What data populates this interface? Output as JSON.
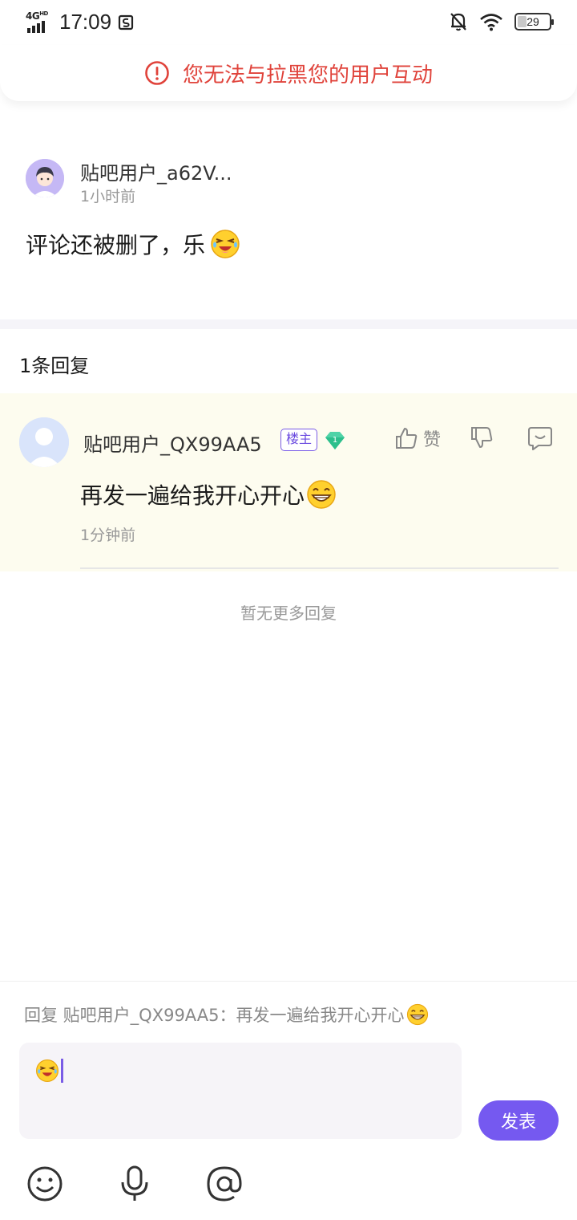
{
  "status_bar": {
    "network": "4G",
    "network_sup": "HD",
    "time": "17:09",
    "battery": "29",
    "icons": [
      "signal-icon",
      "screenshot-icon",
      "bell-off-icon",
      "wifi-icon",
      "battery-icon"
    ]
  },
  "banner": {
    "icon": "alert-circle-icon",
    "text": "您无法与拉黑您的用户互动",
    "color": "#e0433b"
  },
  "post": {
    "username": "贴吧用户_a62V...",
    "time": "1小时前",
    "content": "评论还被删了，乐",
    "emoji": "laughing-tears-emoji"
  },
  "replies": {
    "count_label": "1条回复",
    "items": [
      {
        "username": "贴吧用户_QX99AA5",
        "badge": "楼主",
        "level": "1",
        "like_label": "赞",
        "content": "再发一遍给我开心开心",
        "emoji": "grin-emoji",
        "time": "1分钟前"
      }
    ],
    "no_more": "暂无更多回复"
  },
  "composer": {
    "quote": "回复 贴吧用户_QX99AA5：再发一遍给我开心开心",
    "send_label": "发表",
    "accent": "#7559f0",
    "tools": [
      "emoji-icon",
      "microphone-icon",
      "at-icon"
    ]
  }
}
